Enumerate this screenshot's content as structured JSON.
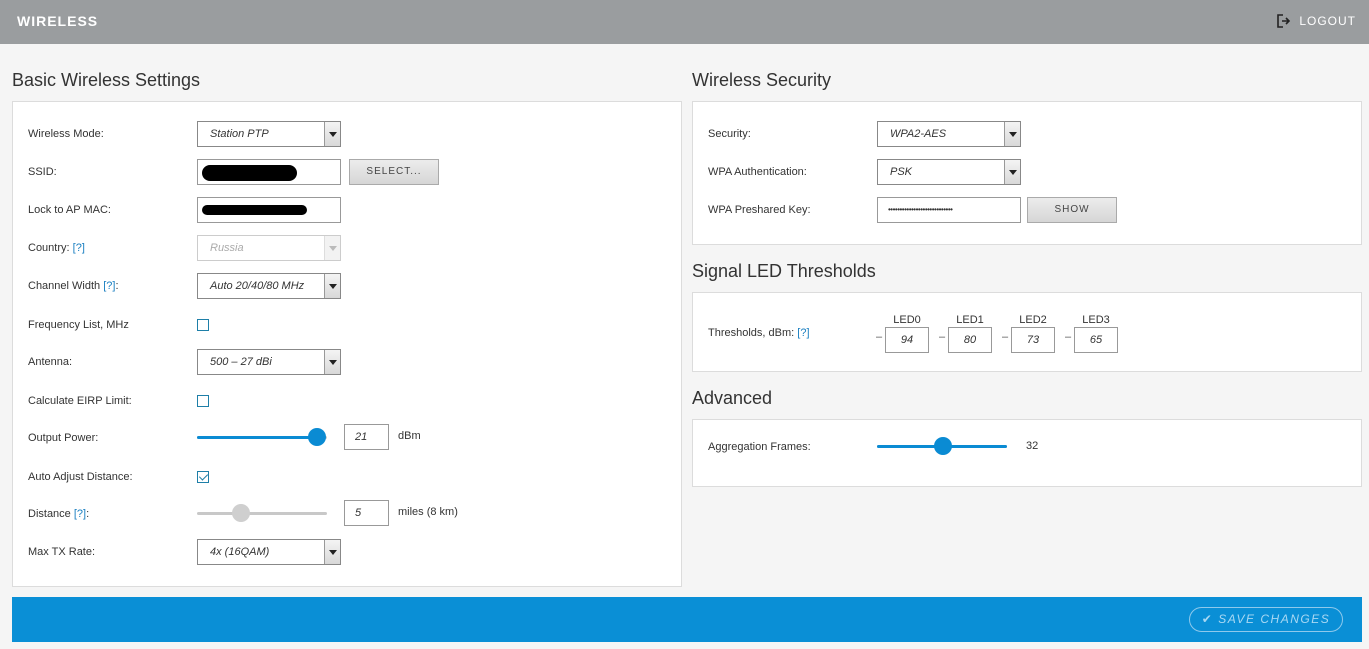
{
  "header": {
    "title": "WIRELESS",
    "logout_label": "LOGOUT"
  },
  "basic": {
    "title": "Basic Wireless Settings",
    "wireless_mode": {
      "label": "Wireless Mode:",
      "value": "Station PTP"
    },
    "ssid": {
      "label": "SSID:",
      "select_button": "SELECT..."
    },
    "lock_to_ap_mac": {
      "label": "Lock to AP MAC:"
    },
    "country": {
      "label": "Country:",
      "help": "[?]",
      "value": "Russia"
    },
    "channel_width": {
      "label": "Channel Width",
      "help": "[?]",
      "suffix": ":",
      "value": "Auto 20/40/80 MHz"
    },
    "frequency_list": {
      "label": "Frequency List, MHz",
      "checked": false
    },
    "antenna": {
      "label": "Antenna:",
      "value": "500 – 27 dBi"
    },
    "calculate_eirp": {
      "label": "Calculate EIRP Limit:",
      "checked": false
    },
    "output_power": {
      "label": "Output Power:",
      "value": "21",
      "unit": "dBm",
      "level": 0.92
    },
    "auto_adjust_distance": {
      "label": "Auto Adjust Distance:",
      "checked": true
    },
    "distance": {
      "label": "Distance",
      "help": "[?]",
      "suffix": ":",
      "value": "5",
      "unit": "miles (8 km)",
      "level": 0.34
    },
    "max_tx_rate": {
      "label": "Max TX Rate:",
      "value": "4x (16QAM)"
    }
  },
  "security": {
    "title": "Wireless Security",
    "security": {
      "label": "Security:",
      "value": "WPA2-AES"
    },
    "wpa_auth": {
      "label": "WPA Authentication:",
      "value": "PSK"
    },
    "wpa_key": {
      "label": "WPA Preshared Key:",
      "value": "••••••••••••••••••••••••••••",
      "show_button": "SHOW"
    }
  },
  "led": {
    "title": "Signal LED Thresholds",
    "label": "Thresholds, dBm:",
    "help": "[?]",
    "leds": [
      {
        "name": "LED0",
        "sign": "–",
        "value": "94"
      },
      {
        "name": "LED1",
        "sign": "–",
        "value": "80"
      },
      {
        "name": "LED2",
        "sign": "–",
        "value": "73"
      },
      {
        "name": "LED3",
        "sign": "–",
        "value": "65"
      }
    ]
  },
  "advanced": {
    "title": "Advanced",
    "aggregation": {
      "label": "Aggregation Frames:",
      "value": "32",
      "level": 0.51
    }
  },
  "footer": {
    "save_label": "SAVE CHANGES"
  },
  "colors": {
    "accent": "#0a8fd6",
    "header": "#9a9d9f"
  }
}
